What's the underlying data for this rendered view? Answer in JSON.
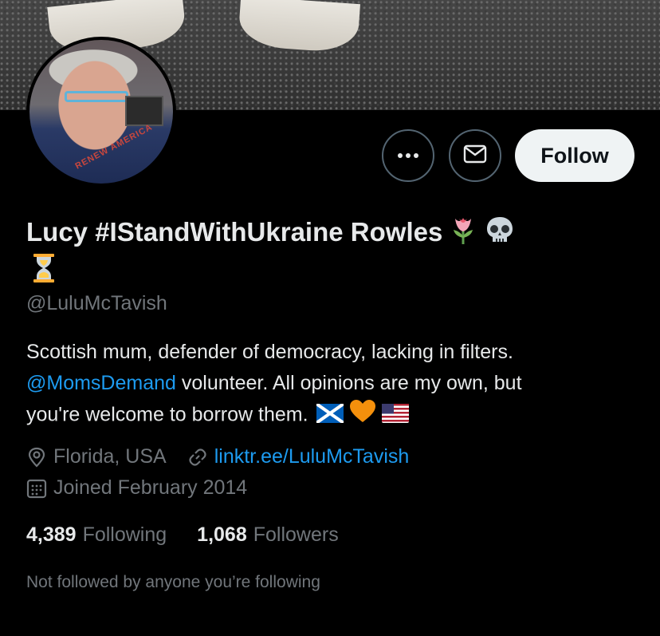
{
  "profile": {
    "display_name": "Lucy #IStandWithUkraine Rowles",
    "name_emojis": [
      "tulip-emoji",
      "skull-emoji",
      "hourglass-emoji"
    ],
    "handle": "@LuluMcTavish",
    "bio": {
      "line1": "Scottish mum, defender of democracy, lacking in filters.",
      "mention": "@MomsDemand",
      "line2_rest": " volunteer. All opinions are my own, but",
      "line3": "you're welcome to borrow them.",
      "emojis": [
        "scotland-flag-emoji",
        "orange-heart-emoji",
        "us-flag-emoji"
      ]
    },
    "location": "Florida, USA",
    "website": "linktr.ee/LuluMcTavish",
    "joined": "Joined February 2014",
    "following_count": "4,389",
    "following_label": "Following",
    "followers_count": "1,068",
    "followers_label": "Followers",
    "mutuals_note": "Not followed by anyone you’re following",
    "avatar_shirt_text": "RENEW AMERICA"
  },
  "actions": {
    "more_icon": "more-horizontal-icon",
    "message_icon": "envelope-icon",
    "follow_label": "Follow"
  },
  "icons": {
    "location": "location-pin-icon",
    "link": "link-icon",
    "calendar": "calendar-icon"
  },
  "colors": {
    "background": "#000000",
    "text_primary": "#e7e9ea",
    "text_secondary": "#71767b",
    "accent_link": "#1d9bf0",
    "follow_button_bg": "#eff3f4",
    "border": "#536471"
  }
}
